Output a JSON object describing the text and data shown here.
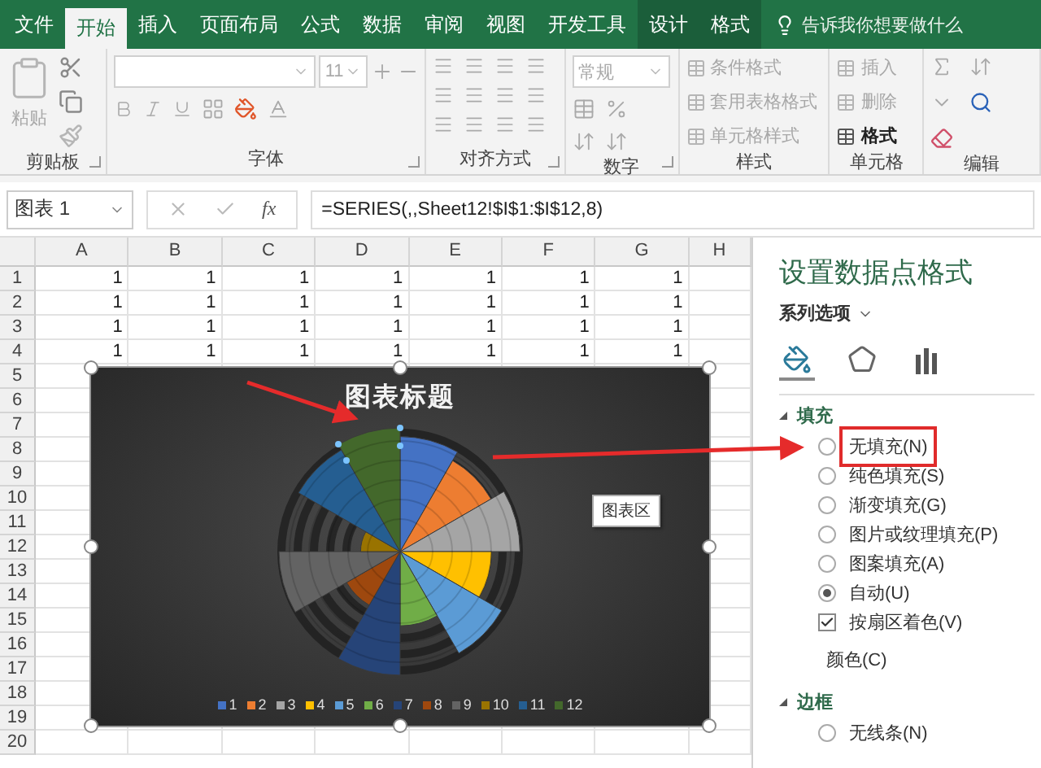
{
  "ribbon_tabs": [
    {
      "label": "文件",
      "selected": false,
      "contextual": false
    },
    {
      "label": "开始",
      "selected": true,
      "contextual": false
    },
    {
      "label": "插入",
      "selected": false,
      "contextual": false
    },
    {
      "label": "页面布局",
      "selected": false,
      "contextual": false
    },
    {
      "label": "公式",
      "selected": false,
      "contextual": false
    },
    {
      "label": "数据",
      "selected": false,
      "contextual": false
    },
    {
      "label": "审阅",
      "selected": false,
      "contextual": false
    },
    {
      "label": "视图",
      "selected": false,
      "contextual": false
    },
    {
      "label": "开发工具",
      "selected": false,
      "contextual": false
    },
    {
      "label": "设计",
      "selected": false,
      "contextual": true
    },
    {
      "label": "格式",
      "selected": false,
      "contextual": true
    }
  ],
  "tell_me": {
    "placeholder": "告诉我你想要做什么"
  },
  "ribbon_groups": [
    {
      "kind": "clipboard",
      "label": "剪贴板",
      "items": [
        {
          "label": "粘贴",
          "disabled": true
        }
      ]
    },
    {
      "kind": "font",
      "label": "字体",
      "font_size": "11"
    },
    {
      "kind": "alignment",
      "label": "对齐方式"
    },
    {
      "kind": "number",
      "label": "数字",
      "format": "常规"
    },
    {
      "kind": "list",
      "label": "样式",
      "items": [
        {
          "label": "条件格式",
          "disabled": true
        },
        {
          "label": "套用表格格式",
          "disabled": true
        },
        {
          "label": "单元格样式",
          "disabled": true
        }
      ]
    },
    {
      "kind": "list",
      "label": "单元格",
      "items": [
        {
          "label": "插入",
          "disabled": true
        },
        {
          "label": "删除",
          "disabled": true
        },
        {
          "label": "格式",
          "disabled": false
        }
      ]
    },
    {
      "kind": "editing",
      "label": "编辑"
    }
  ],
  "formula_bar": {
    "name_box": "图表 1",
    "function_button": "fx",
    "formula": "=SERIES(,,Sheet12!$I$1:$I$12,8)"
  },
  "sheet": {
    "columns": [
      "A",
      "B",
      "C",
      "D",
      "E",
      "F",
      "G",
      "H"
    ],
    "rows": [
      {
        "number": "1",
        "cells": [
          "1",
          "1",
          "1",
          "1",
          "1",
          "1",
          "1"
        ]
      },
      {
        "number": "2",
        "cells": [
          "1",
          "1",
          "1",
          "1",
          "1",
          "1",
          "1"
        ]
      },
      {
        "number": "3",
        "cells": [
          "1",
          "1",
          "1",
          "1",
          "1",
          "1",
          "1"
        ]
      },
      {
        "number": "4",
        "cells": [
          "1",
          "1",
          "1",
          "1",
          "1",
          "1",
          "1"
        ]
      },
      {
        "number": "5",
        "cells": []
      },
      {
        "number": "6",
        "cells": []
      },
      {
        "number": "7",
        "cells": []
      },
      {
        "number": "8",
        "cells": []
      },
      {
        "number": "9",
        "cells": []
      },
      {
        "number": "10",
        "cells": []
      },
      {
        "number": "11",
        "cells": []
      },
      {
        "number": "12",
        "cells": []
      },
      {
        "number": "13",
        "cells": []
      },
      {
        "number": "14",
        "cells": []
      },
      {
        "number": "15",
        "cells": []
      },
      {
        "number": "16",
        "cells": []
      },
      {
        "number": "17",
        "cells": []
      },
      {
        "number": "18",
        "cells": []
      },
      {
        "number": "19",
        "cells": []
      },
      {
        "number": "20",
        "cells": []
      }
    ]
  },
  "chart": {
    "title": "图表标题",
    "tooltip": "图表区",
    "legend": [
      {
        "label": "1",
        "color": "#4472c4"
      },
      {
        "label": "2",
        "color": "#ed7d31"
      },
      {
        "label": "3",
        "color": "#a5a5a5"
      },
      {
        "label": "4",
        "color": "#ffc000"
      },
      {
        "label": "5",
        "color": "#5b9bd5"
      },
      {
        "label": "6",
        "color": "#70ad47"
      },
      {
        "label": "7",
        "color": "#264478"
      },
      {
        "label": "8",
        "color": "#9e480e"
      },
      {
        "label": "9",
        "color": "#636363"
      },
      {
        "label": "10",
        "color": "#997300"
      },
      {
        "label": "11",
        "color": "#255e91"
      },
      {
        "label": "12",
        "color": "#43682b"
      }
    ]
  },
  "format_pane": {
    "title": "设置数据点格式",
    "options_menu": "系列选项",
    "icon_tabs": [
      {
        "kind": "fill",
        "selected": true
      },
      {
        "kind": "effects",
        "selected": false
      },
      {
        "kind": "series",
        "selected": false
      }
    ],
    "sections": [
      {
        "title": "填充",
        "expanded": true,
        "options": [
          {
            "kind": "radio",
            "label": "无填充(N)",
            "selected": false,
            "highlighted": true
          },
          {
            "kind": "radio",
            "label": "纯色填充(S)",
            "selected": false,
            "highlighted": false
          },
          {
            "kind": "radio",
            "label": "渐变填充(G)",
            "selected": false,
            "highlighted": false
          },
          {
            "kind": "radio",
            "label": "图片或纹理填充(P)",
            "selected": false,
            "highlighted": false
          },
          {
            "kind": "radio",
            "label": "图案填充(A)",
            "selected": false,
            "highlighted": false
          },
          {
            "kind": "radio",
            "label": "自动(U)",
            "selected": true,
            "highlighted": false
          },
          {
            "kind": "checkbox",
            "label": "按扇区着色(V)",
            "checked": true
          },
          {
            "kind": "color",
            "label": "颜色(C)"
          }
        ]
      },
      {
        "title": "边框",
        "expanded": true,
        "options": [
          {
            "kind": "radio",
            "label": "无线条(N)",
            "selected": false,
            "highlighted": false
          }
        ]
      }
    ]
  }
}
